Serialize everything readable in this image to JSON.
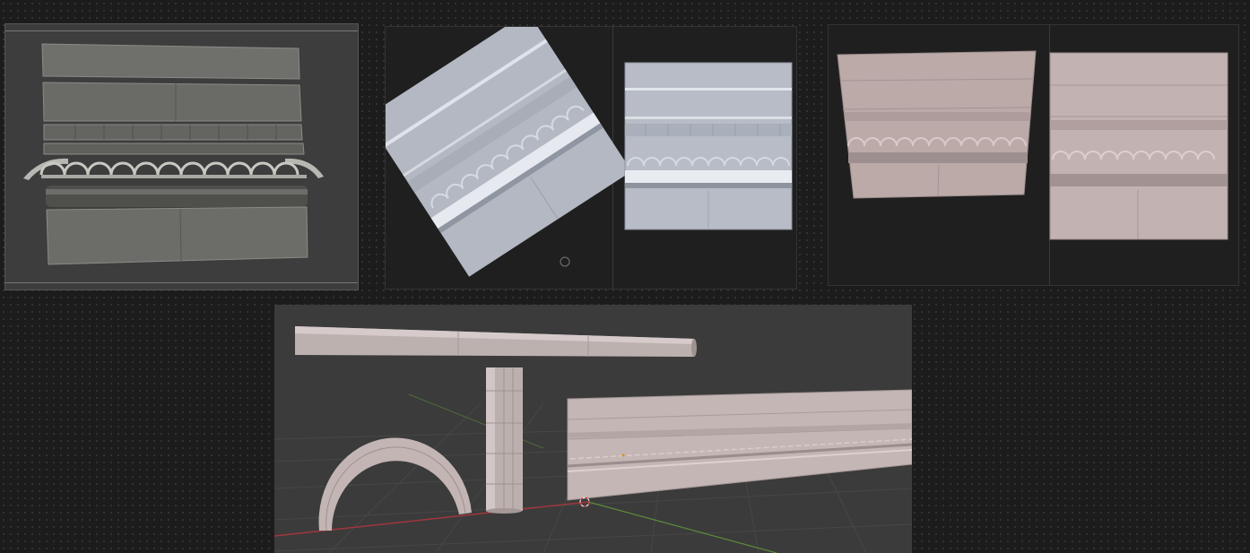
{
  "theme": {
    "sculpt_fill": "#6b6c68",
    "normal_fill": "#b7bcc6",
    "albedo_fill": "#bfaeae",
    "viewport_bg": "#3b3b3b"
  },
  "panels": [
    {
      "name": "sculpt-preview"
    },
    {
      "name": "normal-map-preview"
    },
    {
      "name": "albedo-preview"
    },
    {
      "name": "3d-viewport"
    }
  ],
  "viewport": {
    "objects": [
      "trim-beam",
      "trim-column",
      "trim-arch",
      "trim-wall-strip"
    ],
    "axes": {
      "x_color": "#a0363e",
      "y_color": "#5c8a3a"
    }
  }
}
